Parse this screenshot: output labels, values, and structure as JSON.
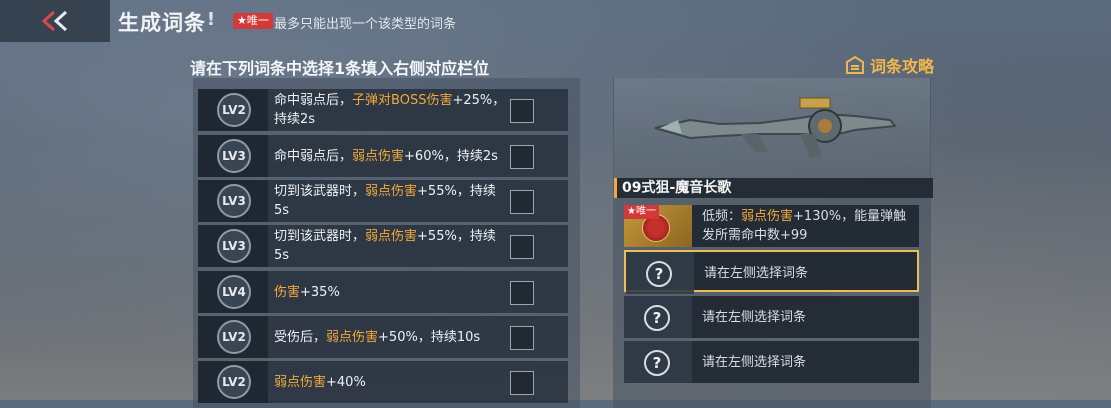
{
  "header": {
    "title": "生成词条",
    "info_icon": "!",
    "unique_badge": "★唯一",
    "unique_note": "最多只能出现一个该类型的词条"
  },
  "left": {
    "heading": "请在下列词条中选择1条填入右侧对应栏位",
    "rows": [
      {
        "level": "LV2",
        "parts": [
          {
            "t": "命中弱点后，",
            "h": false
          },
          {
            "t": "子弹对BOSS伤害",
            "h": true
          },
          {
            "t": "+25%，持续2s",
            "h": false
          }
        ]
      },
      {
        "level": "LV3",
        "parts": [
          {
            "t": "命中弱点后，",
            "h": false
          },
          {
            "t": "弱点伤害",
            "h": true
          },
          {
            "t": "+60%，持续2s",
            "h": false
          }
        ]
      },
      {
        "level": "LV3",
        "parts": [
          {
            "t": "切到该武器时，",
            "h": false
          },
          {
            "t": "弱点伤害",
            "h": true
          },
          {
            "t": "+55%，持续5s",
            "h": false
          }
        ]
      },
      {
        "level": "LV3",
        "parts": [
          {
            "t": "切到该武器时，",
            "h": false
          },
          {
            "t": "弱点伤害",
            "h": true
          },
          {
            "t": "+55%，持续5s",
            "h": false
          }
        ]
      },
      {
        "level": "LV4",
        "parts": [
          {
            "t": "伤害",
            "h": true
          },
          {
            "t": "+35%",
            "h": false
          }
        ]
      },
      {
        "level": "LV2",
        "parts": [
          {
            "t": "受伤后，",
            "h": false
          },
          {
            "t": "弱点伤害",
            "h": true
          },
          {
            "t": "+50%，持续10s",
            "h": false
          }
        ]
      },
      {
        "level": "LV2",
        "parts": [
          {
            "t": "弱点伤害",
            "h": true
          },
          {
            "t": "+40%",
            "h": false
          }
        ]
      }
    ]
  },
  "right": {
    "guide_label": "词条攻略",
    "weapon_name": "09式狙-魔音长歌",
    "filled_slot": {
      "badge": "★唯一",
      "parts": [
        {
          "t": "低频：",
          "h": false
        },
        {
          "t": "弱点伤害",
          "h": true
        },
        {
          "t": "+130%，能量弹触发所需命中数+99",
          "h": false
        }
      ]
    },
    "empty_slots": [
      {
        "icon": "?",
        "text": "请在左侧选择词条"
      },
      {
        "icon": "?",
        "text": "请在左侧选择词条"
      },
      {
        "icon": "?",
        "text": "请在左侧选择词条"
      }
    ]
  },
  "colors": {
    "highlight": "#f2a93b",
    "accent_border": "#e9bf55",
    "badge_red": "#d23a3a"
  },
  "icons": {
    "back": "double-chevron-left-icon",
    "guide": "book-icon",
    "question": "question-icon"
  }
}
